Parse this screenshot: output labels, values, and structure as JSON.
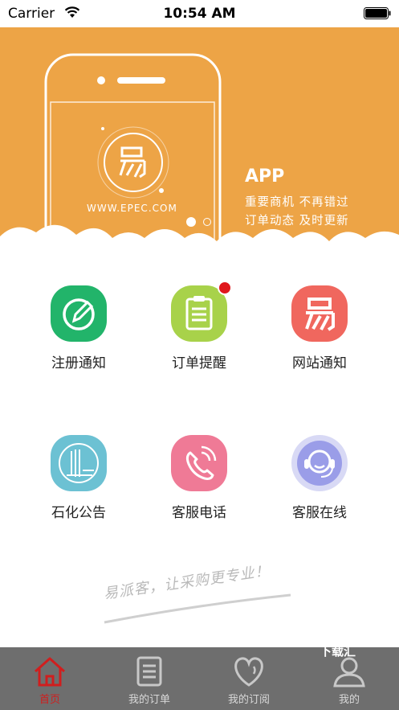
{
  "status_bar": {
    "carrier": "Carrier",
    "time": "10:54 AM"
  },
  "banner": {
    "website": "WWW.EPEC.COM",
    "title": "APP",
    "line1": "重要商机  不再错过",
    "line2": "订单动态  及时更新"
  },
  "grid": [
    {
      "label": "注册通知",
      "icon": "edit-icon",
      "color": "#22b46a"
    },
    {
      "label": "订单提醒",
      "icon": "clipboard-icon",
      "color": "#a8d24a",
      "badge": true
    },
    {
      "label": "网站通知",
      "icon": "epec-logo-icon",
      "color": "#f0675e"
    },
    {
      "label": "石化公告",
      "icon": "sinopec-logo-icon",
      "color": "#6cc1d3"
    },
    {
      "label": "客服电话",
      "icon": "phone-icon",
      "color": "#ef7a96"
    },
    {
      "label": "客服在线",
      "icon": "headset-icon",
      "color": "#9a9de8"
    }
  ],
  "slogan": "易派客，让采购更专业！",
  "tabs": [
    {
      "label": "首页",
      "icon": "home-icon",
      "active": true
    },
    {
      "label": "我的订单",
      "icon": "order-list-icon",
      "active": false
    },
    {
      "label": "我的订阅",
      "icon": "heart-icon",
      "active": false
    },
    {
      "label": "我的",
      "icon": "user-icon",
      "active": false
    }
  ],
  "watermark": "下载汇",
  "colors": {
    "banner": "#eda446",
    "tab_bar": "#6e6e6e",
    "tab_active": "#d01e1e",
    "badge": "#e0171c"
  }
}
